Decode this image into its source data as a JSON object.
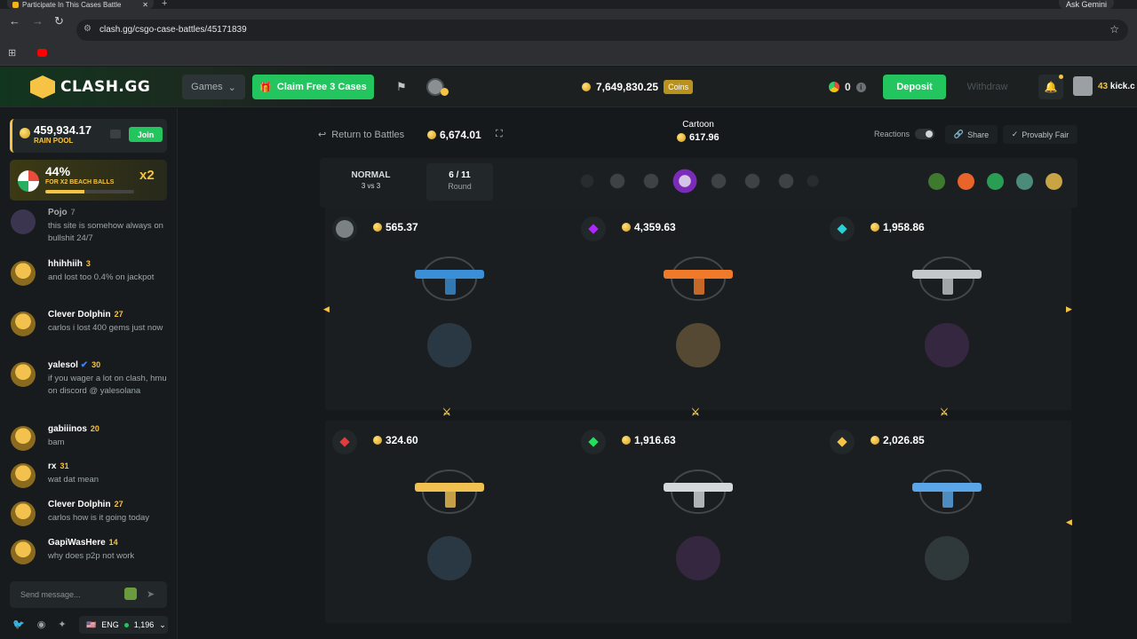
{
  "browser": {
    "tab_title": "Participate In This Cases Battle",
    "url": "clash.gg/csgo-case-battles/45171839",
    "gemini_label": "Ask Gemini"
  },
  "header": {
    "logo_text": "CLASH.GG",
    "games_label": "Games",
    "claim_label": "Claim Free 3 Cases",
    "balance": "7,649,830.25",
    "coins_tag": "Coins",
    "gems": "0",
    "deposit_label": "Deposit",
    "withdraw_label": "Withdraw",
    "profile_level": "43",
    "profile_name": "kick.c"
  },
  "sidebar": {
    "rain_value": "459,934.17",
    "rain_label": "RAIN POOL",
    "join_label": "Join",
    "promo_pct": "44%",
    "promo_progress": 0.44,
    "promo_label": "FOR X2 BEACH BALLS",
    "promo_mult": "x2",
    "messages": [
      {
        "name": "Pojo",
        "level": "7",
        "text": "this site is somehow always on bullshit 24/7"
      },
      {
        "name": "hhihhiih",
        "level": "3",
        "text": "and lost too 0.4% on jackpot"
      },
      {
        "name": "Clever Dolphin",
        "level": "27",
        "text": "carlos i lost 400 gems just now"
      },
      {
        "name": "yalesol",
        "level": "30",
        "text": "if you wager a lot on clash, hmu on discord @ yalesolana"
      },
      {
        "name": "gabiiinos",
        "level": "20",
        "text": "bam"
      },
      {
        "name": "rx",
        "level": "31",
        "text": "wat dat mean"
      },
      {
        "name": "Clever Dolphin",
        "level": "27",
        "text": "carlos how is it going today"
      },
      {
        "name": "GapiWasHere",
        "level": "14",
        "text": "why does p2p not work"
      }
    ],
    "send_placeholder": "Send message...",
    "language": "ENG",
    "online_count": "1,196"
  },
  "battle": {
    "return_label": "Return to Battles",
    "cost": "6,674.01",
    "case_name": "Cartoon",
    "case_price": "617.96",
    "reactions_label": "Reactions",
    "share_label": "Share",
    "fair_label": "Provably Fair",
    "mode": "NORMAL",
    "mode_sub": "3 vs 3",
    "round_value": "6 / 11",
    "round_label": "Round",
    "players": [
      {
        "value": "565.37",
        "color": "#7c8183",
        "item_color": "#3b8fd6"
      },
      {
        "value": "4,359.63",
        "color": "#b026ff",
        "item_color": "#f07a2a"
      },
      {
        "value": "1,958.86",
        "color": "#29d1d9",
        "item_color": "#c4c8ca"
      },
      {
        "value": "324.60",
        "color": "#e23b3b",
        "item_color": "#f0c050"
      },
      {
        "value": "1,916.63",
        "color": "#22e05a",
        "item_color": "#d4d8da"
      },
      {
        "value": "2,026.85",
        "color": "#f6c344",
        "item_color": "#5aa6e8"
      }
    ]
  }
}
